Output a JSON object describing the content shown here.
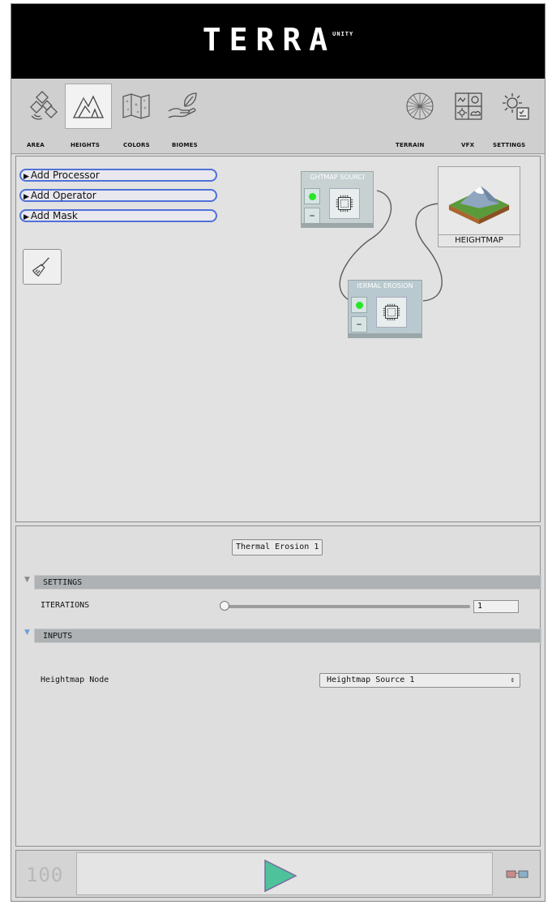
{
  "app": {
    "logo_text": "TERRA",
    "logo_sub": "UNITY"
  },
  "toolbar": {
    "tabs": [
      {
        "label": "AREA",
        "icon": "satellite-icon"
      },
      {
        "label": "HEIGHTS",
        "icon": "mountains-icon",
        "active": true
      },
      {
        "label": "COLORS",
        "icon": "map-icon"
      },
      {
        "label": "BIOMES",
        "icon": "leaf-hand-icon"
      },
      {
        "label": "TERRAIN",
        "icon": "globe-icon"
      },
      {
        "label": "VFX",
        "icon": "weather-icon"
      },
      {
        "label": "SETTINGS",
        "icon": "gear-icon"
      }
    ]
  },
  "graph": {
    "add_processor": "Add Processor",
    "add_operator": "Add Operator",
    "add_mask": "Add Mask",
    "nodes": {
      "source_title": "GHTMAP SOURCI",
      "erosion_title": "IERMAL EROSION",
      "output_label": "HEIGHTMAP"
    }
  },
  "inspector": {
    "node_name": "Thermal Erosion 1",
    "settings_header": "SETTINGS",
    "iterations_label": "ITERATIONS",
    "iterations_value": "1",
    "iterations_slider_fraction": 0.0,
    "inputs_header": "INPUTS",
    "heightmap_node_label": "Heightmap Node",
    "heightmap_node_value": "Heightmap Source 1"
  },
  "bottom": {
    "counter": "100",
    "play_icon": "play-icon",
    "glasses_icon": "glasses-icon"
  },
  "colors": {
    "accent_blue": "#4f71d9",
    "node_active_green": "#27e627",
    "play_teal": "#4ec29a"
  }
}
